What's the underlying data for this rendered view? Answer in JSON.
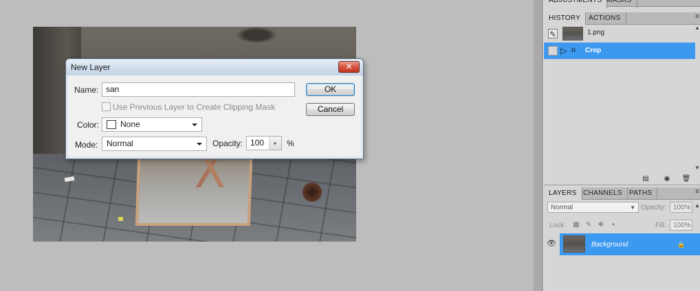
{
  "dialog": {
    "title": "New Layer",
    "close_glyph": "✕",
    "name_label": "Name:",
    "name_value": "san",
    "clipping_label": "Use Previous Layer to Create Clipping Mask",
    "color_label": "Color:",
    "color_value": "None",
    "mode_label": "Mode:",
    "mode_value": "Normal",
    "opacity_label": "Opacity:",
    "opacity_value": "100",
    "opacity_unit": "%",
    "ok_label": "OK",
    "cancel_label": "Cancel"
  },
  "panels": {
    "top_tabs": [
      "ADJUSTMENTS",
      "MASKS"
    ],
    "history_tabs": [
      "HISTORY",
      "ACTIONS"
    ],
    "history_items": [
      {
        "label": "1.png",
        "icon": "document-thumbnail"
      },
      {
        "label": "Crop",
        "icon": "crop-icon",
        "selected": true
      }
    ],
    "layers_tabs": [
      "LAYERS",
      "CHANNELS",
      "PATHS"
    ],
    "blend_mode": "Normal",
    "opacity_label": "Opacity:",
    "opacity_value": "100%",
    "lock_label": "Lock:",
    "fill_label": "Fill:",
    "fill_value": "100%",
    "layer_name": "Background",
    "menu_glyph": "≡"
  },
  "colors": {
    "selection_blue": "#3d98f0",
    "canvas_bg": "#bdbdbd",
    "panel_bg": "#d6d6d6"
  }
}
